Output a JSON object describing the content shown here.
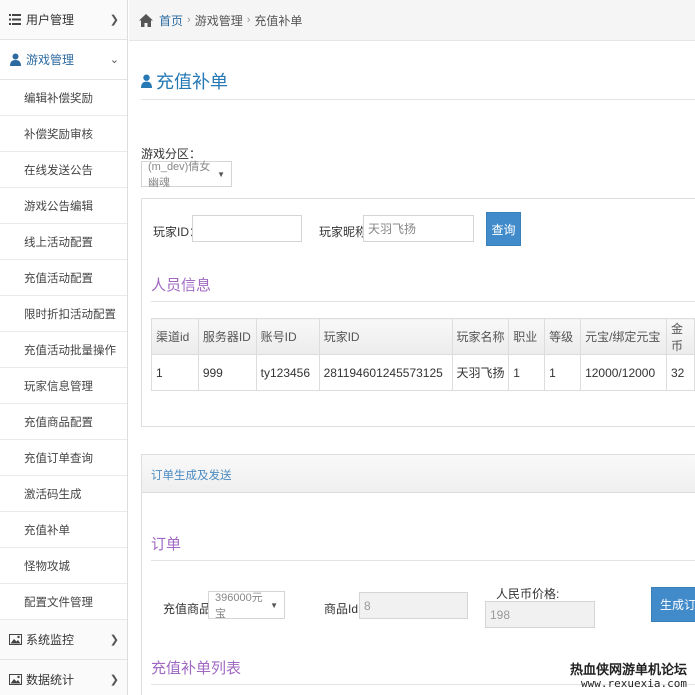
{
  "sidebar": {
    "groups": {
      "user_mgmt": "用户管理",
      "game_mgmt": "游戏管理",
      "sys_monitor": "系统监控",
      "data_stats": "数据统计"
    },
    "items": [
      {
        "label": "编辑补偿奖励"
      },
      {
        "label": "补偿奖励审核"
      },
      {
        "label": "在线发送公告"
      },
      {
        "label": "游戏公告编辑"
      },
      {
        "label": "线上活动配置"
      },
      {
        "label": "充值活动配置"
      },
      {
        "label": "限时折扣活动配置"
      },
      {
        "label": "充值活动批量操作"
      },
      {
        "label": "玩家信息管理"
      },
      {
        "label": "充值商品配置"
      },
      {
        "label": "充值订单查询"
      },
      {
        "label": "激活码生成"
      },
      {
        "label": "充值补单"
      },
      {
        "label": "怪物攻城"
      },
      {
        "label": "配置文件管理"
      }
    ]
  },
  "breadcrumb": {
    "home": "首页",
    "sep": "›",
    "level1": "游戏管理",
    "level2": "充值补单"
  },
  "page": {
    "title": "充值补单"
  },
  "filters": {
    "zone_label": "游戏分区：",
    "zone_value": "(m_dev)倩女幽魂",
    "player_id_label": "玩家ID：",
    "player_id_value": "",
    "nickname_label": "玩家昵称：",
    "nickname_value": "天羽飞扬",
    "query_button": "查询"
  },
  "user_info": {
    "title": "人员信息",
    "columns": [
      "渠道id",
      "服务器ID",
      "账号ID",
      "玩家ID",
      "玩家名称",
      "职业",
      "等级",
      "元宝/绑定元宝",
      "金币"
    ],
    "rows": [
      [
        "1",
        "999",
        "ty123456",
        "281194601245573125",
        "天羽飞扬",
        "1",
        "1",
        "12000/12000",
        "32"
      ]
    ]
  },
  "order_panel": {
    "tab": "订单生成及发送",
    "title": "订单",
    "product_label": "充值商品：",
    "product_value": "396000元宝",
    "product_id_label": "商品Id：",
    "product_id_value": "8",
    "rmb_label": "人民币价格:",
    "rmb_value": "198",
    "generate_button": "生成订单"
  },
  "list_section": {
    "title": "充值补单列表"
  },
  "watermark": {
    "line1": "热血侠网游单机论坛",
    "line2": "www.rexuexia.com"
  },
  "colors": {
    "accent": "#2679b5",
    "section": "#a069c3",
    "button": "#428bca"
  }
}
